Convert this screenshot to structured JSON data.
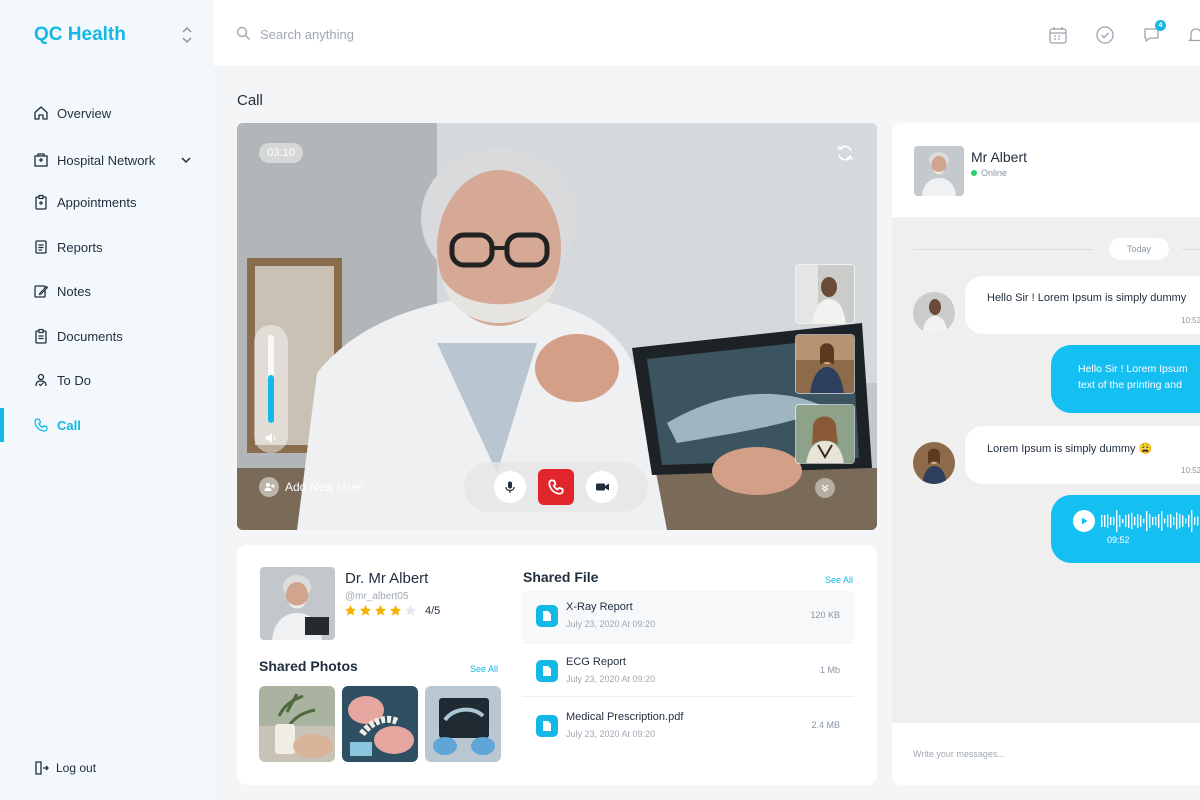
{
  "brand": {
    "name": "QC Health"
  },
  "colors": {
    "accent": "#14b8e6",
    "end_call": "#e0262b",
    "online": "#2ecc71",
    "star": "#f5b301"
  },
  "sidebar": {
    "items": [
      {
        "label": "Overview",
        "icon": "home-icon"
      },
      {
        "label": "Hospital Network",
        "icon": "hospital-icon"
      },
      {
        "label": "Appointments",
        "icon": "clipboard-icon"
      },
      {
        "label": "Reports",
        "icon": "document-icon"
      },
      {
        "label": "Notes",
        "icon": "edit-note-icon"
      },
      {
        "label": "Documents",
        "icon": "documents-icon"
      },
      {
        "label": "To Do",
        "icon": "todo-icon"
      },
      {
        "label": "Call",
        "icon": "phone-icon",
        "active": true
      }
    ],
    "logout_label": "Log out"
  },
  "topbar": {
    "search_placeholder": "Search anything",
    "notification_count": "4"
  },
  "page": {
    "title": "Call"
  },
  "video": {
    "timer": "03:10",
    "volume_level": 0.55,
    "add_user_label": "Add New User"
  },
  "doctor": {
    "name": "Dr. Mr Albert",
    "handle": "@mr_albert05",
    "rating_text": "4/5",
    "rating": 4
  },
  "shared_photos": {
    "title": "Shared Photos",
    "see_all": "See All"
  },
  "shared_files": {
    "title": "Shared File",
    "see_all": "See All",
    "files": [
      {
        "name": "X-Ray Report",
        "date": "July 23, 2020 At 09:20",
        "size": "120 KB"
      },
      {
        "name": "ECG Report",
        "date": "July 23, 2020 At 09:20",
        "size": "1 Mb"
      },
      {
        "name": "Medical Prescription.pdf",
        "date": "July 23, 2020 At 09:20",
        "size": "2.4 MB"
      }
    ]
  },
  "chat": {
    "contact_name": "Mr Albert",
    "contact_status": "Online",
    "day_label": "Today",
    "messages": [
      {
        "text": "Hello Sir ! Lorem Ipsum is simply dummy",
        "time": "10:52"
      },
      {
        "line1": "Hello Sir ! Lorem Ipsum",
        "line2": "text of the printing and"
      },
      {
        "text": "Lorem Ipsum is simply dummy 😩",
        "time": "10:52"
      },
      {
        "duration": "09:52"
      }
    ],
    "input_placeholder": "Write your messages..."
  }
}
